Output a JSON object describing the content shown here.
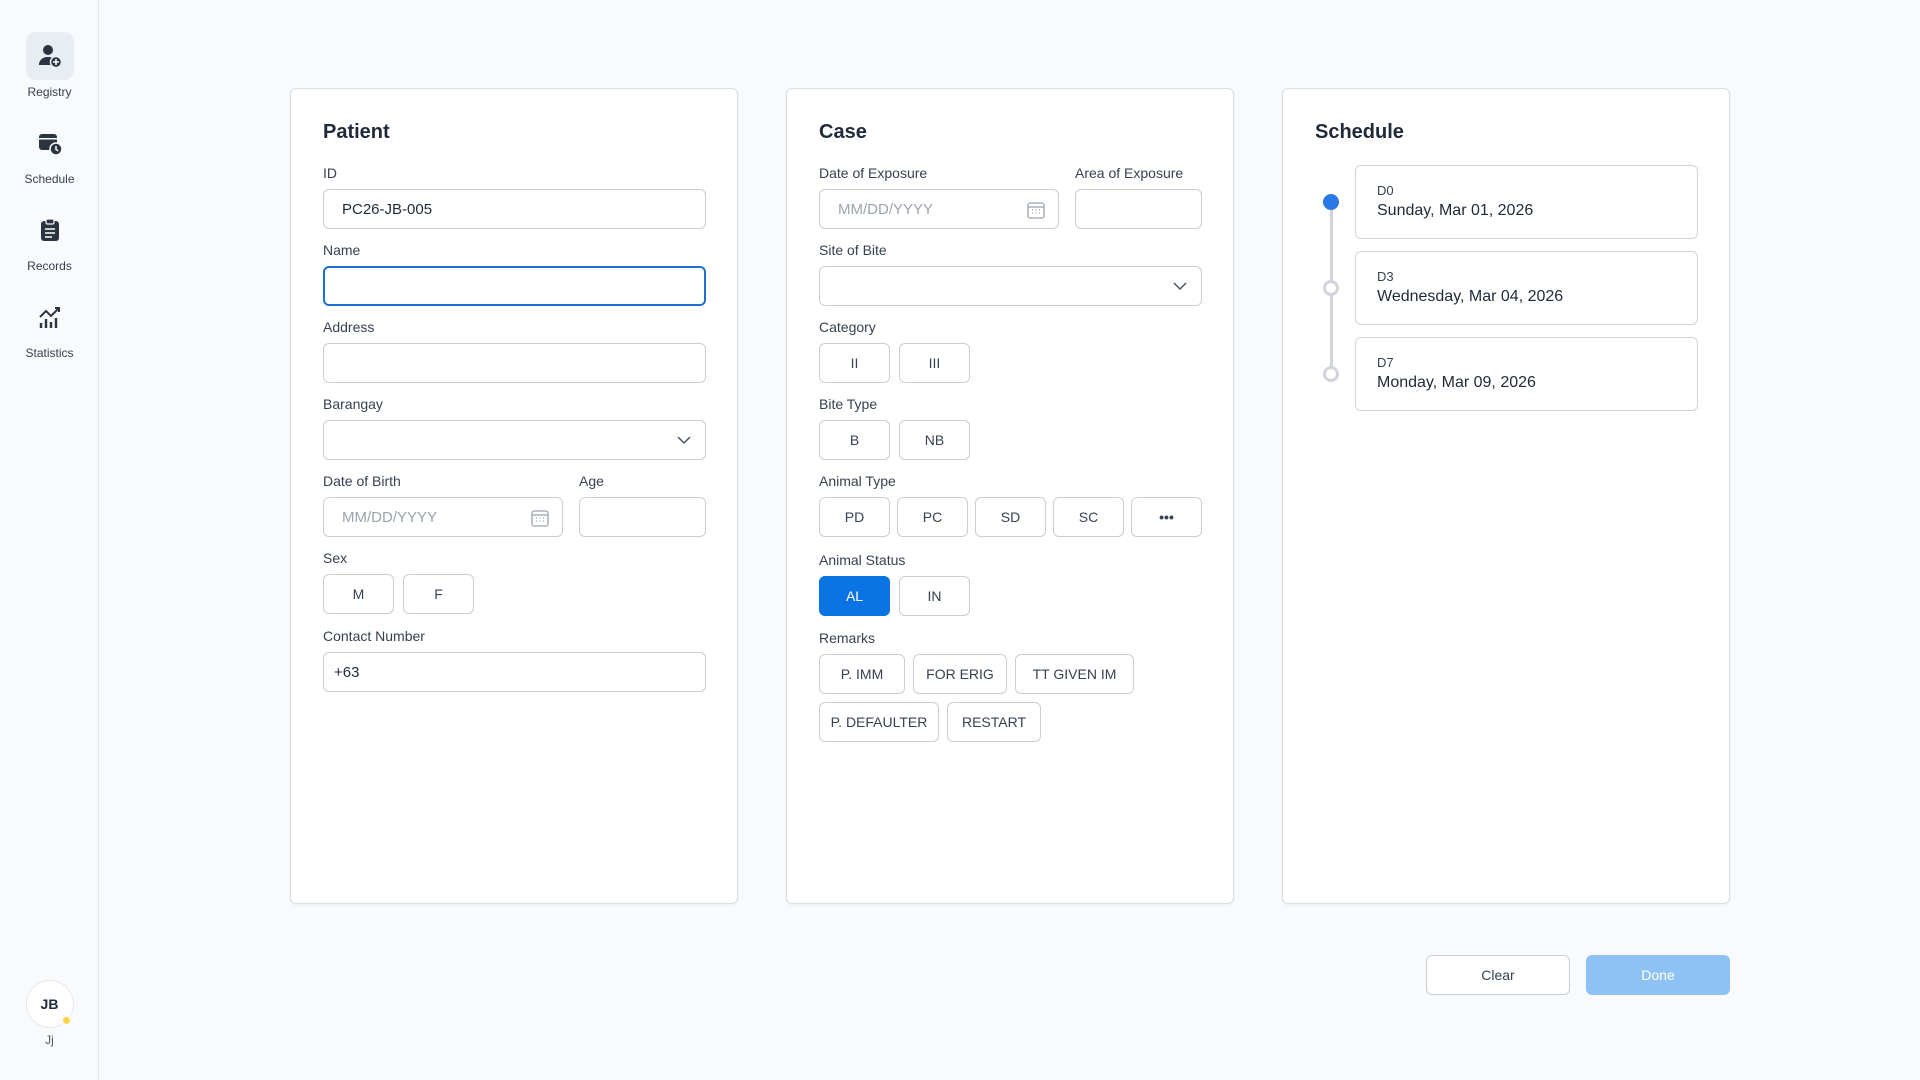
{
  "sidebar": {
    "items": [
      {
        "label": "Registry",
        "icon": "user-plus-icon",
        "active": true
      },
      {
        "label": "Schedule",
        "icon": "calendar-clock-icon"
      },
      {
        "label": "Records",
        "icon": "clipboard-icon"
      },
      {
        "label": "Statistics",
        "icon": "chart-line-icon"
      }
    ],
    "user": {
      "initials": "JB",
      "name": "Jj",
      "status_color": "#fbd34d"
    }
  },
  "patient": {
    "title": "Patient",
    "id_label": "ID",
    "id_value": "PC26-JB-005",
    "name_label": "Name",
    "name_value": "",
    "address_label": "Address",
    "address_value": "",
    "barangay_label": "Barangay",
    "barangay_value": "",
    "dob_label": "Date of Birth",
    "dob_placeholder": "MM/DD/YYYY",
    "age_label": "Age",
    "age_value": "",
    "sex_label": "Sex",
    "sex_options": [
      "M",
      "F"
    ],
    "contact_label": "Contact Number",
    "contact_value": "+63"
  },
  "case": {
    "title": "Case",
    "exposure_date_label": "Date of Exposure",
    "exposure_date_placeholder": "MM/DD/YYYY",
    "exposure_area_label": "Area of Exposure",
    "exposure_area_value": "",
    "site_label": "Site of Bite",
    "site_value": "",
    "category_label": "Category",
    "category_options": [
      "II",
      "III"
    ],
    "bite_type_label": "Bite Type",
    "bite_type_options": [
      "B",
      "NB"
    ],
    "animal_type_label": "Animal Type",
    "animal_type_options": [
      "PD",
      "PC",
      "SD",
      "SC",
      "•••"
    ],
    "animal_status_label": "Animal Status",
    "animal_status_options": [
      "AL",
      "IN"
    ],
    "animal_status_selected": "AL",
    "remarks_label": "Remarks",
    "remarks_options": [
      "P. IMM",
      "FOR ERIG",
      "TT GIVEN IM",
      "P. DEFAULTER",
      "RESTART"
    ]
  },
  "schedule": {
    "title": "Schedule",
    "doses": [
      {
        "code": "D0",
        "date": "Sunday, Mar 01, 2026",
        "active": true
      },
      {
        "code": "D3",
        "date": "Wednesday, Mar 04, 2026",
        "active": false
      },
      {
        "code": "D7",
        "date": "Monday, Mar 09, 2026",
        "active": false
      }
    ]
  },
  "actions": {
    "clear_label": "Clear",
    "done_label": "Done"
  },
  "colors": {
    "accent": "#0b74e5",
    "focus": "#1d6fd6",
    "done_disabled": "#8ec2f5"
  }
}
